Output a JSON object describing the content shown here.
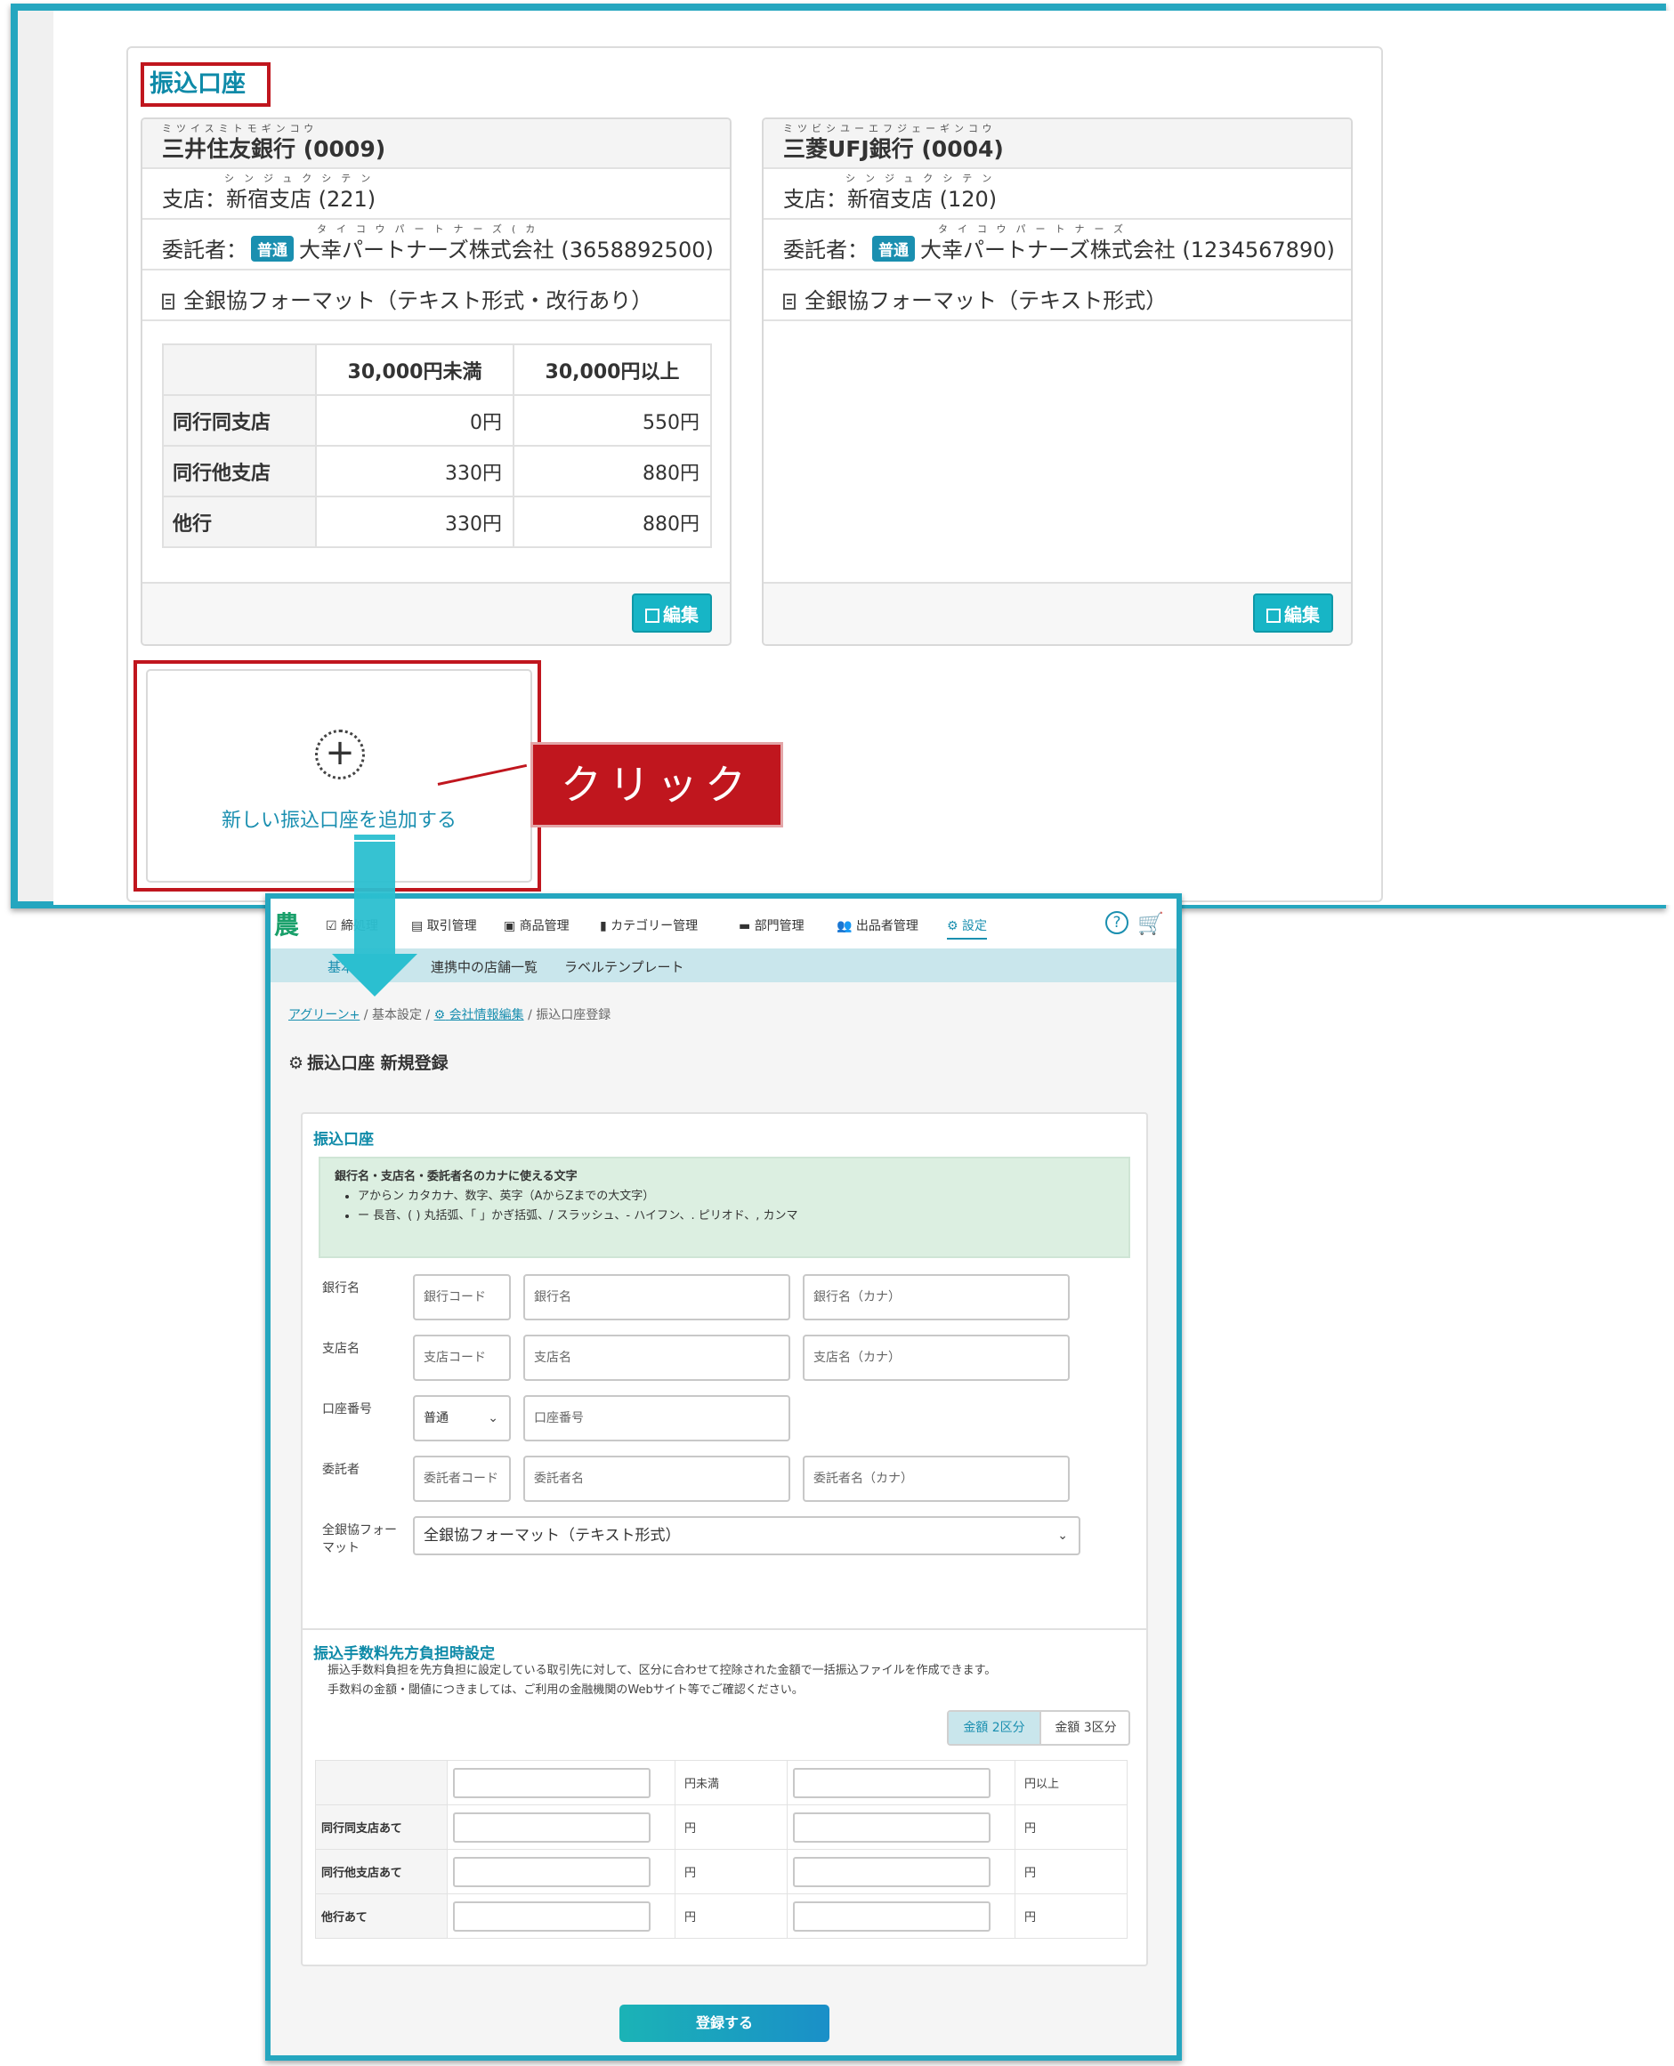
{
  "top": {
    "section_title": "振込口座",
    "accounts": [
      {
        "bank_ruby": "ミツイスミトモギンコウ",
        "bank": "三井住友銀行 (0009)",
        "branch_ruby": "シンジュクシテン",
        "branch": "支店：新宿支店 (221)",
        "consignor_label": "委託者：",
        "account_type": "普通",
        "consignor_ruby": "タイコウパートナーズ(カ",
        "consignor": "大幸パートナーズ株式会社 (3658892500)",
        "format": "全銀協フォーマット（テキスト形式・改行あり）",
        "fee_table": {
          "headers": [
            "30,000円未満",
            "30,000円以上"
          ],
          "rows": [
            {
              "label": "同行同支店",
              "values": [
                "0円",
                "550円"
              ]
            },
            {
              "label": "同行他支店",
              "values": [
                "330円",
                "880円"
              ]
            },
            {
              "label": "他行",
              "values": [
                "330円",
                "880円"
              ]
            }
          ]
        },
        "edit_label": "編集"
      },
      {
        "bank_ruby": "ミツビシユーエフジェーギンコウ",
        "bank": "三菱UFJ銀行 (0004)",
        "branch_ruby": "シンジュクシテン",
        "branch": "支店：新宿支店 (120)",
        "consignor_label": "委託者：",
        "account_type": "普通",
        "consignor_ruby": "タイコウパートナーズ",
        "consignor": "大幸パートナーズ株式会社 (1234567890)",
        "format": "全銀協フォーマット（テキスト形式）",
        "edit_label": "編集"
      }
    ],
    "add_account_label": "新しい振込口座を追加する",
    "click_callout": "クリック"
  },
  "app": {
    "logo": "農",
    "nav": [
      "締処理",
      "取引管理",
      "商品管理",
      "カテゴリー管理",
      "部門管理",
      "出品者管理",
      "設定"
    ],
    "help_icon": "?",
    "subnav": [
      "基本設定",
      "連携中の店舗一覧",
      "ラベルテンプレート"
    ],
    "breadcrumb": {
      "root": "アグリーン+",
      "sep": "/",
      "basic": "基本設定",
      "company": "会社情報編集",
      "current": "振込口座登録"
    },
    "page_title": "振込口座 新規登録",
    "form": {
      "heading": "振込口座",
      "info_title": "銀行名・支店名・委託者名のカナに使える文字",
      "info_items": [
        "アからン カタカナ、数字、英字（AからZまでの大文字）",
        "ー 長音、( ) 丸括弧、「 」かぎ括弧、/ スラッシュ、- ハイフン、. ピリオド、, カンマ"
      ],
      "labels": {
        "bank": "銀行名",
        "branch": "支店名",
        "account_no": "口座番号",
        "consignor": "委託者",
        "format": "全銀協フォーマット"
      },
      "placeholders": {
        "bank_code": "銀行コード",
        "bank_name": "銀行名",
        "bank_kana": "銀行名（カナ）",
        "branch_code": "支店コード",
        "branch_name": "支店名",
        "branch_kana": "支店名（カナ）",
        "account_no": "口座番号",
        "consignor_code": "委託者コード",
        "consignor_name": "委託者名",
        "consignor_kana": "委託者名（カナ）"
      },
      "account_type": "普通",
      "format_value": "全銀協フォーマット（テキスト形式）"
    },
    "fee": {
      "heading": "振込手数料先方負担時設定",
      "desc1": "振込手数料負担を先方負担に設定している取引先に対して、区分に合わせて控除された金額で一括振込ファイルを作成できます。",
      "desc2": "手数料の金額・閾値につきましては、ご利用の金融機関のWebサイト等でご確認ください。",
      "toggle": [
        "金額 2区分",
        "金額 3区分"
      ],
      "header_units": [
        "円未満",
        "円以上"
      ],
      "rows": [
        "同行同支店あて",
        "同行他支店あて",
        "他行あて"
      ],
      "unit": "円"
    },
    "register_label": "登録する"
  }
}
